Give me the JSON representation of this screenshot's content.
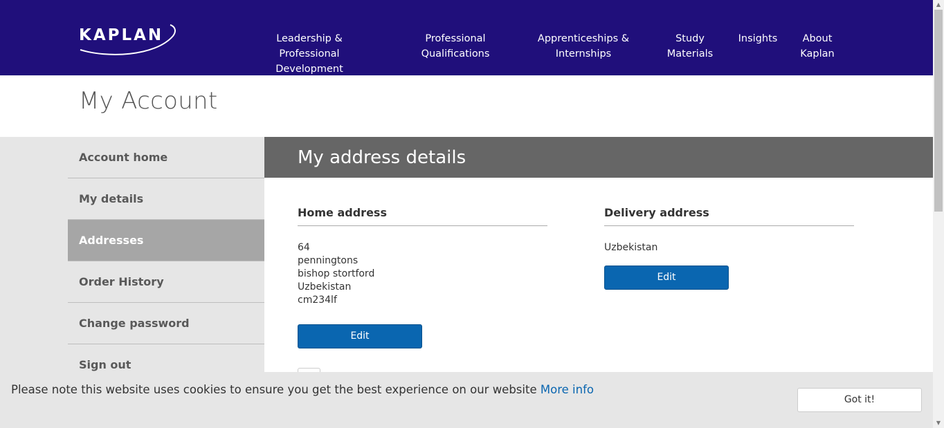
{
  "brand": {
    "logo_text": "KAPLAN",
    "nav_bg": "#200f7b",
    "accent": "#0a66b0"
  },
  "nav": [
    {
      "line1": "Leadership & Professional",
      "line2": "Development"
    },
    {
      "line1": "Professional",
      "line2": "Qualifications"
    },
    {
      "line1": "Apprenticeships &",
      "line2": "Internships"
    },
    {
      "line1": "Study",
      "line2": "Materials"
    },
    {
      "line1": "Insights",
      "line2": ""
    },
    {
      "line1": "About",
      "line2": "Kaplan"
    }
  ],
  "page": {
    "title": "My Account"
  },
  "sidebar": {
    "items": [
      {
        "label": "Account home"
      },
      {
        "label": "My details"
      },
      {
        "label": "Addresses",
        "active": true
      },
      {
        "label": "Order History"
      },
      {
        "label": "Change password"
      },
      {
        "label": "Sign out"
      }
    ]
  },
  "panel": {
    "title": "My address details",
    "home": {
      "heading": "Home address",
      "lines": [
        "64",
        "penningtons",
        "bishop stortford",
        "Uzbekistan",
        "cm234lf"
      ],
      "edit_label": "Edit"
    },
    "delivery": {
      "heading": "Delivery address",
      "lines": [
        "Uzbekistan"
      ],
      "edit_label": "Edit"
    }
  },
  "cookie": {
    "message": "Please note this website uses cookies to ensure you get the best experience on our website",
    "link": "More info",
    "button": "Got it!"
  },
  "scrollbar": {
    "up_icon": "triangle-up",
    "down_icon": "triangle-down"
  }
}
